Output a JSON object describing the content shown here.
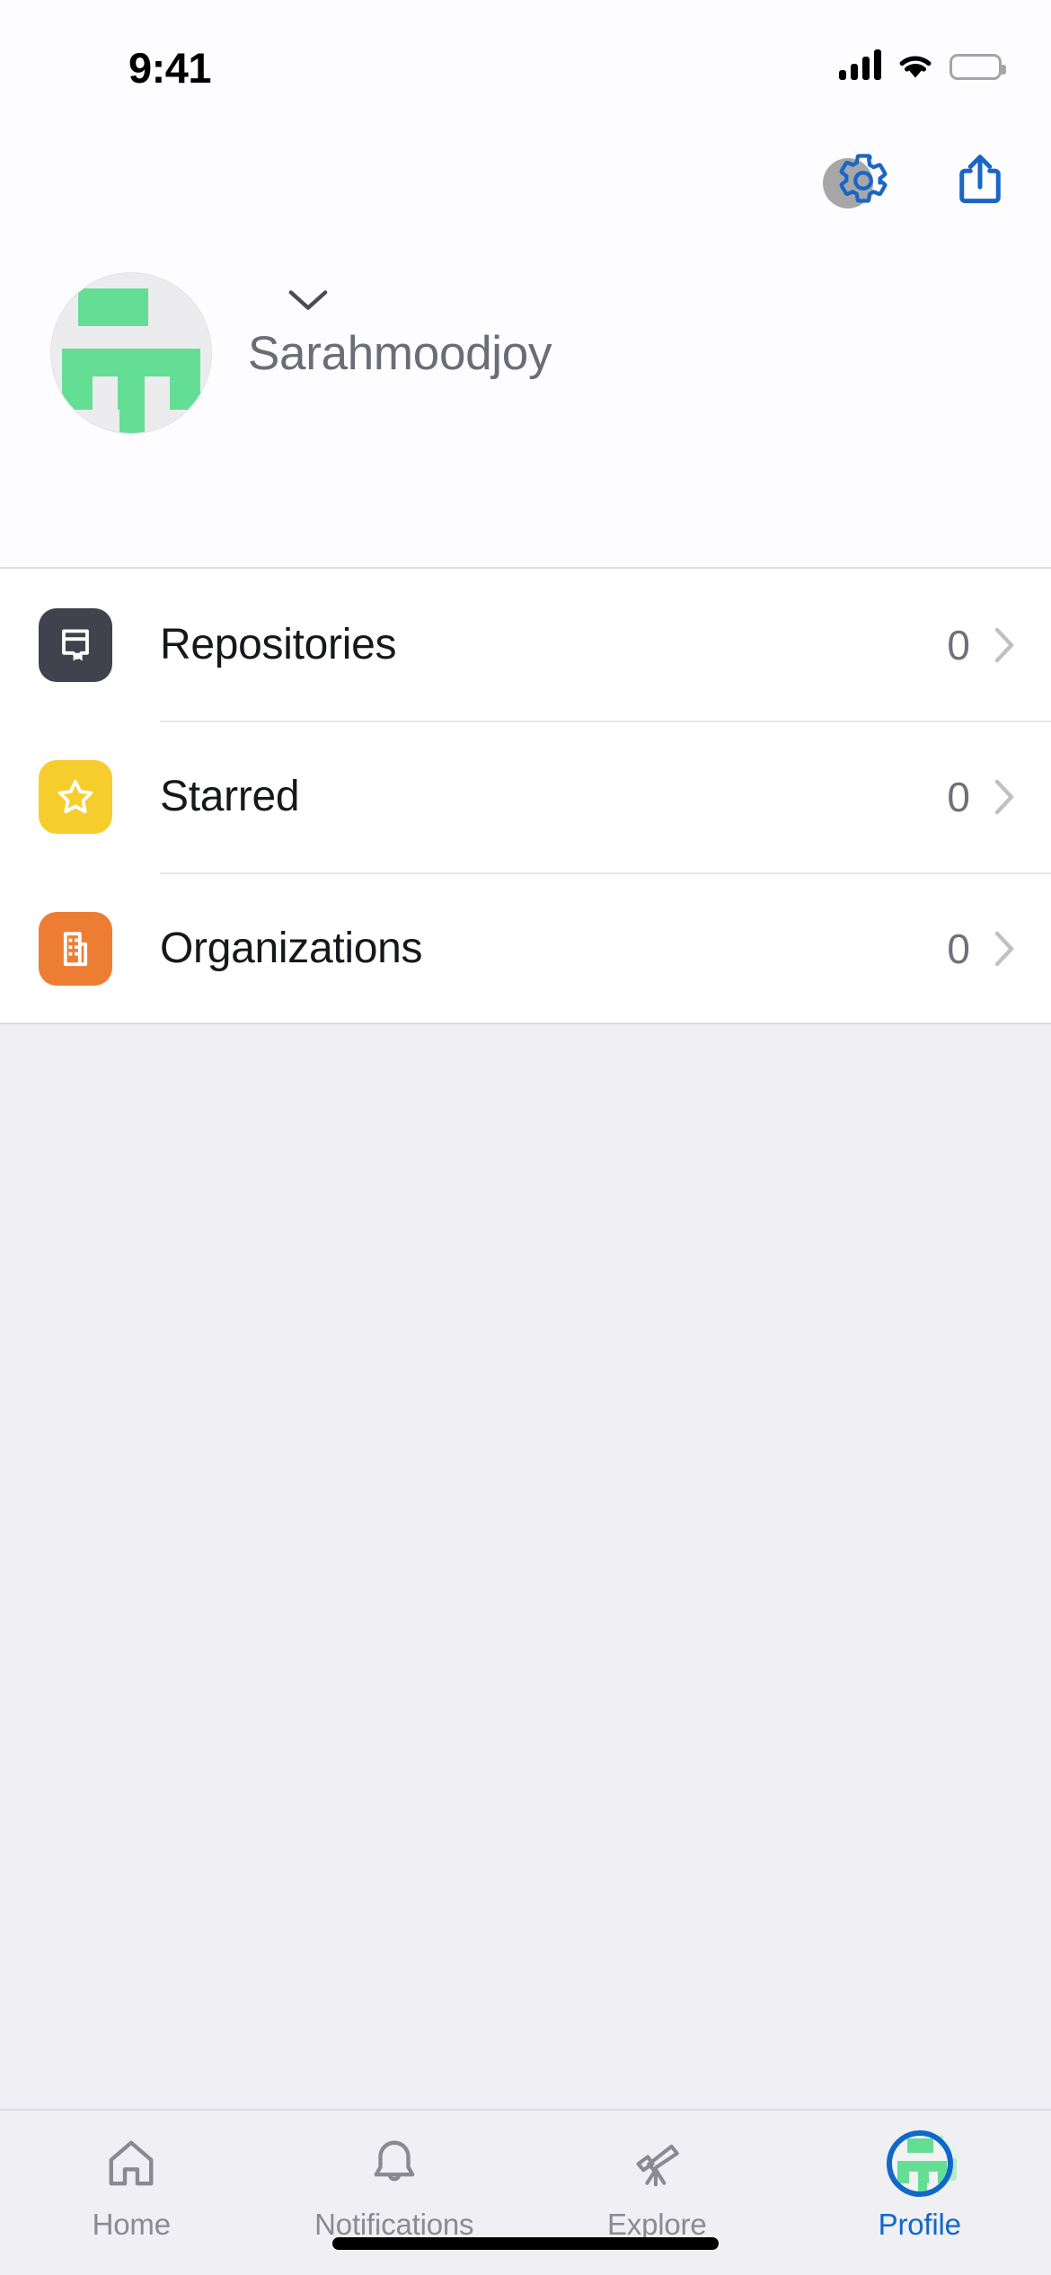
{
  "status_bar": {
    "time": "9:41",
    "signal_icon": "cellular-bars-icon",
    "wifi_icon": "wifi-icon",
    "battery_icon": "battery-full-icon"
  },
  "header": {
    "actions": [
      {
        "name": "settings-button",
        "icon": "gear-icon",
        "color": "#1A66C4",
        "has_touch_indicator": true
      },
      {
        "name": "share-button",
        "icon": "share-icon",
        "color": "#1A66C4",
        "has_touch_indicator": false
      }
    ],
    "avatar": {
      "icon": "avatar-identicon",
      "pattern_color": "#65DE95",
      "background": "#ECECEE"
    },
    "expand_icon": "chevron-down-icon",
    "username": "Sarahmoodjoy"
  },
  "list": {
    "rows": [
      {
        "label": "Repositories",
        "count": "0",
        "icon": "repo-book-icon",
        "icon_bg": "#42424E",
        "chevron": "chevron-right-icon"
      },
      {
        "label": "Starred",
        "count": "0",
        "icon": "star-icon",
        "icon_bg": "#F5CE2E",
        "chevron": "chevron-right-icon"
      },
      {
        "label": "Organizations",
        "count": "0",
        "icon": "organization-building-icon",
        "icon_bg": "#EE7D34",
        "chevron": "chevron-right-icon"
      }
    ]
  },
  "tab_bar": {
    "active_color": "#1168C9",
    "inactive_color": "#8A8A90",
    "tabs": [
      {
        "label": "Home",
        "icon": "home-icon",
        "active": false
      },
      {
        "label": "Notifications",
        "icon": "bell-icon",
        "active": false
      },
      {
        "label": "Explore",
        "icon": "telescope-icon",
        "active": false
      },
      {
        "label": "Profile",
        "icon": "avatar-identicon",
        "active": true
      }
    ]
  },
  "system": {
    "home_indicator": "home-indicator"
  }
}
